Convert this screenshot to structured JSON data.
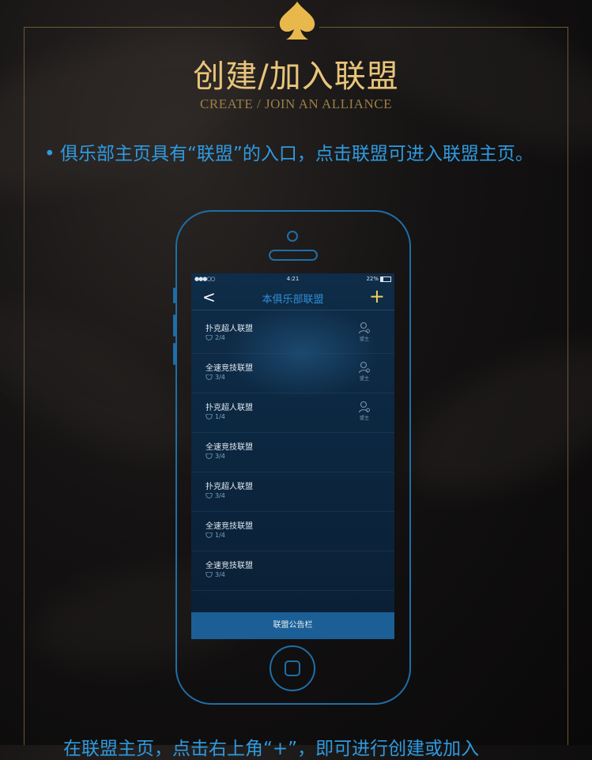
{
  "header": {
    "title_cn": "创建/加入联盟",
    "title_en": "CREATE / JOIN AN ALLIANCE"
  },
  "bullet": {
    "marker": "•",
    "text": "俱乐部主页具有“联盟”的入口，点击联盟可进入联盟主页。"
  },
  "phone": {
    "status": {
      "signal": "●●●○○",
      "time": "4:21",
      "battery": "22%"
    },
    "nav": {
      "back_icon": "chevron-left-icon",
      "back": "<",
      "title": "本俱乐部联盟",
      "add": "+"
    },
    "alliances": [
      {
        "name": "扑克超人联盟",
        "count": "2/4",
        "owner": true,
        "owner_label": "盟主"
      },
      {
        "name": "全速竞技联盟",
        "count": "3/4",
        "owner": true,
        "owner_label": "盟主"
      },
      {
        "name": "扑克超人联盟",
        "count": "1/4",
        "owner": true,
        "owner_label": "盟主"
      },
      {
        "name": "全速竞技联盟",
        "count": "3/4",
        "owner": false,
        "owner_label": ""
      },
      {
        "name": "扑克超人联盟",
        "count": "3/4",
        "owner": false,
        "owner_label": ""
      },
      {
        "name": "全速竞技联盟",
        "count": "1/4",
        "owner": false,
        "owner_label": ""
      },
      {
        "name": "全速竞技联盟",
        "count": "3/4",
        "owner": false,
        "owner_label": ""
      }
    ],
    "bottom_bar": "联盟公告栏"
  },
  "footer": {
    "partial_text": "在联盟主页，点击右上角“+”，即可进行创建或加入"
  },
  "colors": {
    "gold": "#e9c57a",
    "accent_blue": "#2f9be0",
    "phone_outline": "#1d6fa8",
    "bottom_bar": "#1b5f96"
  }
}
